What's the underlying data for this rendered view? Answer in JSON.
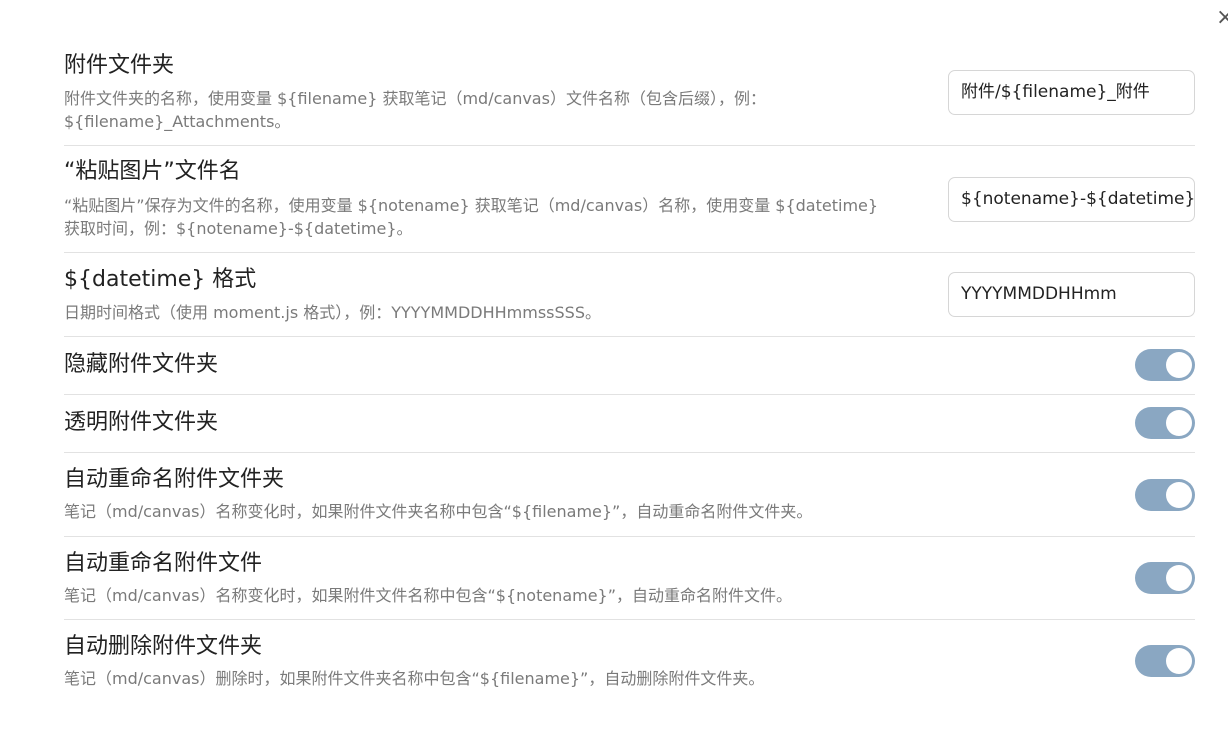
{
  "settings": [
    {
      "name": "附件文件夹",
      "desc1": "附件文件夹的名称，使用变量 ${filename} 获取笔记（md/canvas）文件名称（包含后缀），例：",
      "desc2": "${filename}_Attachments。",
      "value": "附件/${filename}_附件"
    },
    {
      "name": "“粘贴图片”文件名",
      "desc1": "“粘贴图片”保存为文件的名称，使用变量 ${notename} 获取笔记（md/canvas）名称，使用变量 ${datetime}",
      "desc2": "获取时间，例：${notename}-${datetime}。",
      "value": "${notename}-${datetime}"
    },
    {
      "name": "${datetime} 格式",
      "desc1": "日期时间格式（使用 moment.js 格式），例：YYYYMMDDHHmmssSSS。",
      "value": "YYYYMMDDHHmm"
    },
    {
      "name": "隐藏附件文件夹",
      "enabled": true
    },
    {
      "name": "透明附件文件夹",
      "enabled": true
    },
    {
      "name": "自动重命名附件文件夹",
      "desc1": "笔记（md/canvas）名称变化时，如果附件文件夹名称中包含“${filename}”，自动重命名附件文件夹。",
      "enabled": true
    },
    {
      "name": "自动重命名附件文件",
      "desc1": "笔记（md/canvas）名称变化时，如果附件文件名称中包含“${notename}”，自动重命名附件文件。",
      "enabled": true
    },
    {
      "name": "自动删除附件文件夹",
      "desc1": "笔记（md/canvas）删除时，如果附件文件夹名称中包含“${filename}”，自动删除附件文件夹。",
      "enabled": true
    }
  ],
  "close_glyph": "×",
  "accent_color": "#8aa7c2"
}
